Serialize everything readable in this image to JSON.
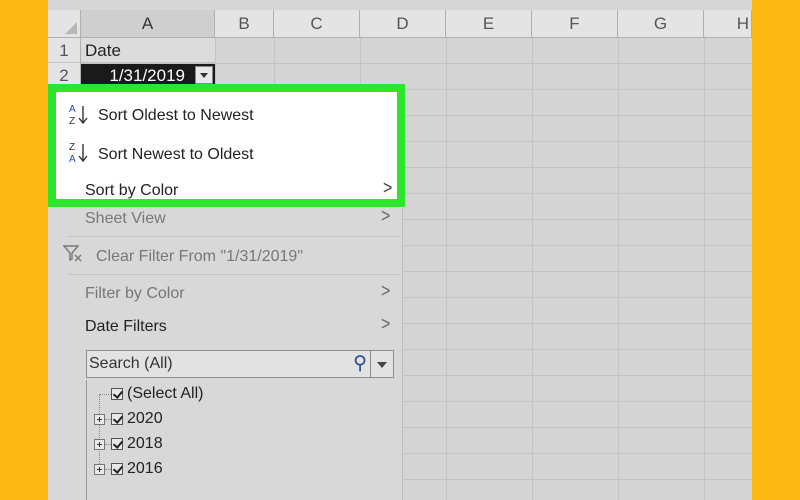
{
  "columns": [
    "A",
    "B",
    "C",
    "D",
    "E",
    "F",
    "G",
    "H"
  ],
  "rows": [
    "1",
    "2"
  ],
  "cells": {
    "a1": "Date",
    "a2": "1/31/2019"
  },
  "menu": {
    "sort_oldest": "Sort Oldest to Newest",
    "sort_newest": "Sort Newest to Oldest",
    "sort_by_color": "Sort by Color",
    "sheet_view": "Sheet View",
    "clear_filter": "Clear Filter From \"1/31/2019\"",
    "filter_by_color": "Filter by Color",
    "date_filters": "Date Filters",
    "search_placeholder": "Search (All)",
    "tree": [
      "(Select All)",
      "2020",
      "2018",
      "2016"
    ]
  },
  "colors": {
    "highlight": "#2EE52E",
    "background": "#FDB813"
  }
}
